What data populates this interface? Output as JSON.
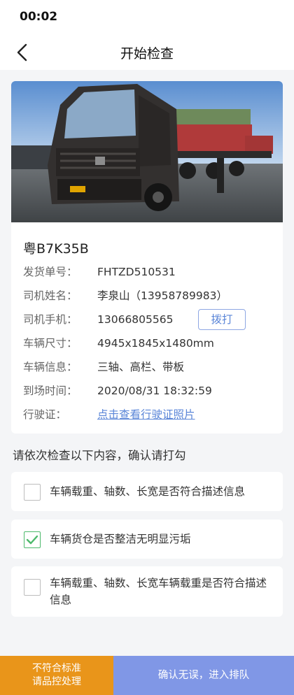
{
  "status_bar": {
    "time": "00:02"
  },
  "nav": {
    "title": "开始检查",
    "back_icon": "chevron-left-icon"
  },
  "vehicle": {
    "photo_icon": "truck-photo",
    "plate": "粤B7K35B",
    "rows": [
      {
        "label": "发货单号：",
        "value": "FHTZD510531"
      },
      {
        "label": "司机姓名：",
        "value": "李泉山（13958789983）"
      },
      {
        "label": "司机手机：",
        "value": "13066805565",
        "action": "拨打"
      },
      {
        "label": "车辆尺寸：",
        "value": "4945x1845x1480mm"
      },
      {
        "label": "车辆信息：",
        "value": "三轴、高栏、带板"
      },
      {
        "label": "到场时间：",
        "value": "2020/08/31 18:32:59"
      },
      {
        "label": "行驶证：",
        "value": "点击查看行驶证照片"
      }
    ]
  },
  "checklist": {
    "prompt": "请依次检查以下内容，确认请打勾",
    "items": [
      {
        "text": "车辆载重、轴数、长宽是否符合描述信息",
        "checked": false
      },
      {
        "text": "车辆货仓是否整洁无明显污垢",
        "checked": true
      },
      {
        "text": "车辆载重、轴数、长宽车辆载重是否符合描述信息",
        "checked": false
      }
    ]
  },
  "footer": {
    "reject_line1": "不符合标准",
    "reject_line2": "请品控处理",
    "confirm": "确认无误，进入排队"
  },
  "colors": {
    "accent": "#5b86d8",
    "reject": "#e9951a",
    "confirm": "#8097e6",
    "check": "#4cb96b"
  }
}
